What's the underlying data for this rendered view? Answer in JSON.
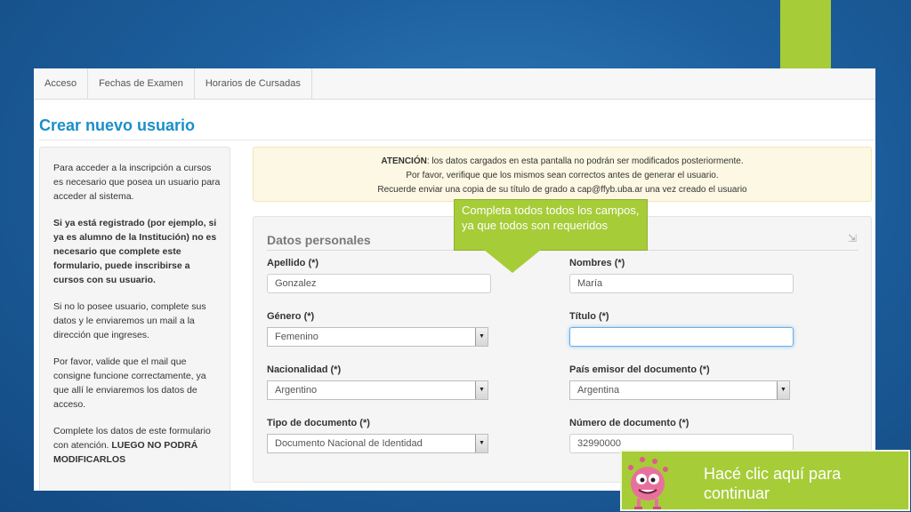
{
  "nav": {
    "items": [
      "Acceso",
      "Fechas de Examen",
      "Horarios de Cursadas"
    ]
  },
  "page": {
    "title": "Crear nuevo usuario"
  },
  "sidebar": {
    "p1": "Para acceder a la inscripción a cursos es necesario que posea un usuario para acceder al sistema.",
    "p2": "Si ya está registrado (por ejemplo, si ya es alumno de la Institución) no es necesario que complete este formulario, puede inscribirse a cursos con su usuario.",
    "p3": "Si no lo posee usuario, complete sus datos y le enviaremos un mail a la dirección que ingreses.",
    "p4": "Por favor, valide que el mail que consigne funcione correctamente, ya que allí le enviaremos los datos de acceso.",
    "p5_normal": "Complete los datos de este formulario con atención. ",
    "p5_bold": "LUEGO NO PODRÁ MODIFICARLOS"
  },
  "alert": {
    "strong": "ATENCIÓN",
    "line1": ": los datos cargados en esta pantalla no podrán ser modificados posteriormente.",
    "line2": "Por favor, verifique que los mismos sean correctos antes de generar el usuario.",
    "line3": "Recuerde enviar una copia de su título de grado a cap@ffyb.uba.ar una vez creado el usuario"
  },
  "form": {
    "legend": "Datos personales",
    "apellido": {
      "label": "Apellido (*)",
      "value": "Gonzalez"
    },
    "nombres": {
      "label": "Nombres (*)",
      "value": "María"
    },
    "genero": {
      "label": "Género (*)",
      "value": "Femenino"
    },
    "titulo": {
      "label": "Título (*)",
      "value": ""
    },
    "nacionalidad": {
      "label": "Nacionalidad (*)",
      "value": "Argentino"
    },
    "pais": {
      "label": "País emisor del documento (*)",
      "value": "Argentina"
    },
    "tipo_doc": {
      "label": "Tipo de documento (*)",
      "value": "Documento Nacional de Identidad"
    },
    "num_doc": {
      "label": "Número de documento (*)",
      "value": "32990000"
    }
  },
  "callout": {
    "text": "Completa todos todos los campos, ya que todos son requeridos"
  },
  "cta": {
    "text": "Hacé clic aquí para continuar"
  },
  "colors": {
    "accent_green": "#a6cc38",
    "title_blue": "#1b8fc9",
    "background_blue": "#1d5f9e"
  }
}
